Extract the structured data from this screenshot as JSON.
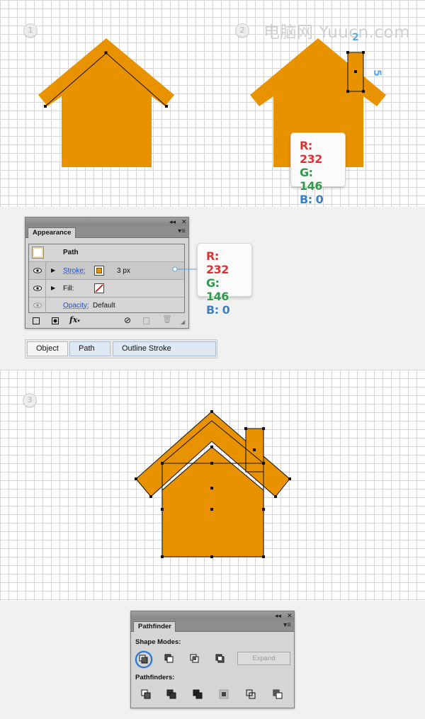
{
  "watermark": "电脑网 Yuucn.com",
  "steps": {
    "one": "1",
    "two": "2",
    "three": "3"
  },
  "colors": {
    "house_fill": "#e89200",
    "house_fill_rgb": [
      232,
      146,
      0
    ],
    "grid_line": "#d6d6d6",
    "selection_stroke": "#1a1a1a"
  },
  "chimney_dims": {
    "width": "2",
    "height": "5"
  },
  "rgb_tooltip": {
    "r": "R: 232",
    "g": "G: 146",
    "b": "B: 0"
  },
  "appearance_panel": {
    "tab": "Appearance",
    "header_title": "Path",
    "stroke": {
      "label": "Stroke:",
      "value": "3 px"
    },
    "fill": {
      "label": "Fill:"
    },
    "opacity": {
      "label": "Opacity:",
      "value": "Default"
    },
    "fx_label": "fx"
  },
  "control_bar": {
    "object": "Object",
    "path": "Path",
    "outline_stroke": "Outline Stroke"
  },
  "pathfinder_panel": {
    "tab": "Pathfinder",
    "shape_modes_label": "Shape Modes:",
    "pathfinders_label": "Pathfinders:",
    "expand_label": "Expand"
  },
  "icons": [
    "collapse-icon",
    "close-icon",
    "panel-menu-icon",
    "visibility-eye-icon",
    "disclosure-triangle-icon",
    "new-stroke-icon",
    "new-fill-icon",
    "clear-appearance-icon",
    "duplicate-item-icon",
    "delete-item-icon",
    "unite-icon",
    "minus-front-icon",
    "intersect-icon",
    "exclude-icon",
    "divide-icon",
    "trim-icon",
    "merge-icon",
    "crop-icon",
    "outline-icon",
    "minus-back-icon"
  ]
}
